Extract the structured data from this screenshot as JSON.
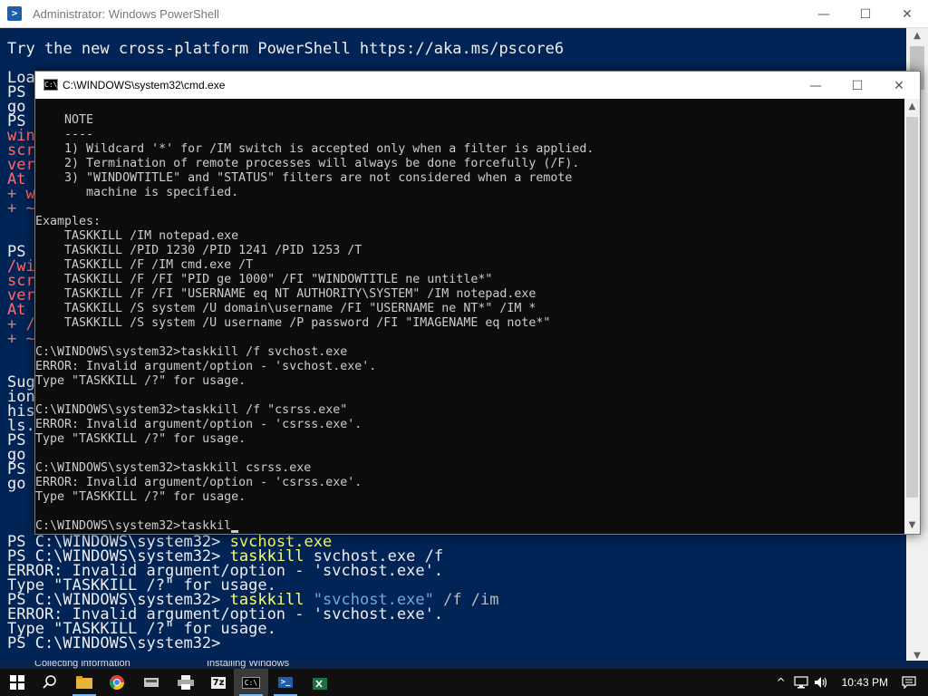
{
  "powershell": {
    "title": "Administrator: Windows PowerShell",
    "banner": "Try the new cross-platform PowerShell https://aka.ms/pscore6",
    "left_fragments": [
      {
        "text": "Loa",
        "color": "white"
      },
      {
        "text": "PS",
        "color": "white"
      },
      {
        "text": "go",
        "color": "white"
      },
      {
        "text": "PS",
        "color": "white"
      },
      {
        "text": "win",
        "color": "red"
      },
      {
        "text": "scr",
        "color": "red"
      },
      {
        "text": "ver",
        "color": "red"
      },
      {
        "text": "At",
        "color": "red"
      },
      {
        "text": "+ w",
        "color": "red"
      },
      {
        "text": "+ ~",
        "color": "red"
      },
      {
        "text": "",
        "color": "white"
      },
      {
        "text": "",
        "color": "white"
      },
      {
        "text": "PS",
        "color": "white"
      },
      {
        "text": "/wi",
        "color": "red"
      },
      {
        "text": "scr",
        "color": "red"
      },
      {
        "text": "ver",
        "color": "red"
      },
      {
        "text": "At",
        "color": "red"
      },
      {
        "text": "+ /",
        "color": "red"
      },
      {
        "text": "+ ~",
        "color": "red"
      },
      {
        "text": "",
        "color": "white"
      },
      {
        "text": "",
        "color": "white"
      },
      {
        "text": "Sug",
        "color": "white"
      },
      {
        "text": "ion",
        "color": "white"
      },
      {
        "text": "his",
        "color": "white"
      },
      {
        "text": "ls.",
        "color": "white"
      },
      {
        "text": "PS",
        "color": "white"
      },
      {
        "text": "go",
        "color": "white"
      },
      {
        "text": "PS",
        "color": "white"
      },
      {
        "text": "go",
        "color": "white"
      }
    ],
    "bottom_lines": [
      {
        "segments": [
          {
            "text": "PS C:\\WINDOWS\\system32> ",
            "color": "white"
          },
          {
            "text": "svchost.exe",
            "color": "yellow"
          }
        ]
      },
      {
        "segments": [
          {
            "text": "PS C:\\WINDOWS\\system32> ",
            "color": "white"
          },
          {
            "text": "taskkill",
            "color": "yellow"
          },
          {
            "text": " svchost.exe /f",
            "color": "white"
          }
        ]
      },
      {
        "segments": [
          {
            "text": "ERROR: Invalid argument/option - 'svchost.exe'.",
            "color": "white"
          }
        ]
      },
      {
        "segments": [
          {
            "text": "Type \"TASKKILL /?\" for usage.",
            "color": "white"
          }
        ]
      },
      {
        "segments": [
          {
            "text": "PS C:\\WINDOWS\\system32> ",
            "color": "white"
          },
          {
            "text": "taskkill",
            "color": "yellow"
          },
          {
            "text": " ",
            "color": "white"
          },
          {
            "text": "\"svchost.exe\"",
            "color": "blue"
          },
          {
            "text": " /f /im",
            "color": "gray"
          }
        ]
      },
      {
        "segments": [
          {
            "text": "ERROR: Invalid argument/option - 'svchost.exe'.",
            "color": "white"
          }
        ]
      },
      {
        "segments": [
          {
            "text": "Type \"TASKKILL /?\" for usage.",
            "color": "white"
          }
        ]
      },
      {
        "segments": [
          {
            "text": "PS C:\\WINDOWS\\system32>",
            "color": "white"
          }
        ]
      }
    ]
  },
  "cmd": {
    "title": "C:\\WINDOWS\\system32\\cmd.exe",
    "icon_label": "C:\\",
    "lines": [
      "",
      "    NOTE",
      "    ----",
      "    1) Wildcard '*' for /IM switch is accepted only when a filter is applied.",
      "    2) Termination of remote processes will always be done forcefully (/F).",
      "    3) \"WINDOWTITLE\" and \"STATUS\" filters are not considered when a remote",
      "       machine is specified.",
      "",
      "Examples:",
      "    TASKKILL /IM notepad.exe",
      "    TASKKILL /PID 1230 /PID 1241 /PID 1253 /T",
      "    TASKKILL /F /IM cmd.exe /T",
      "    TASKKILL /F /FI \"PID ge 1000\" /FI \"WINDOWTITLE ne untitle*\"",
      "    TASKKILL /F /FI \"USERNAME eq NT AUTHORITY\\SYSTEM\" /IM notepad.exe",
      "    TASKKILL /S system /U domain\\username /FI \"USERNAME ne NT*\" /IM *",
      "    TASKKILL /S system /U username /P password /FI \"IMAGENAME eq note*\"",
      "",
      "C:\\WINDOWS\\system32>taskkill /f svchost.exe",
      "ERROR: Invalid argument/option - 'svchost.exe'.",
      "Type \"TASKKILL /?\" for usage.",
      "",
      "C:\\WINDOWS\\system32>taskkill /f \"csrss.exe\"",
      "ERROR: Invalid argument/option - 'csrss.exe'.",
      "Type \"TASKKILL /?\" for usage.",
      "",
      "C:\\WINDOWS\\system32>taskkill csrss.exe",
      "ERROR: Invalid argument/option - 'csrss.exe'.",
      "Type \"TASKKILL /?\" for usage.",
      ""
    ],
    "input_line": "C:\\WINDOWS\\system32>taskkil"
  },
  "notifications": {
    "left": "Collecting information",
    "right": "Installing Windows"
  },
  "taskbar": {
    "clock": "10:43 PM",
    "items": [
      {
        "name": "start",
        "icon": "windows-logo-icon"
      },
      {
        "name": "search",
        "icon": "search-icon"
      },
      {
        "name": "file-explorer",
        "icon": "folder-icon"
      },
      {
        "name": "chrome",
        "icon": "chrome-icon"
      },
      {
        "name": "app-1",
        "icon": "drive-icon"
      },
      {
        "name": "app-2",
        "icon": "printer-icon"
      },
      {
        "name": "7zip",
        "icon": "7zip-icon"
      },
      {
        "name": "cmd",
        "icon": "cmd-icon"
      },
      {
        "name": "powershell",
        "icon": "powershell-icon"
      },
      {
        "name": "app-3",
        "icon": "spreadsheet-icon"
      }
    ],
    "seven_zip_label": "7z",
    "cmd_label": "C:\\",
    "ps_label": ">_",
    "tray_icons": [
      "chevron-up-icon",
      "network-icon",
      "volume-icon"
    ],
    "colors": {
      "taskbar_bg": "#101010",
      "accent": "#76b9ed"
    }
  },
  "colors": {
    "ps_bg": "#012456",
    "cmd_bg": "#0c0c0c",
    "yellow": "#ffff66",
    "red": "#ff6b6b"
  }
}
